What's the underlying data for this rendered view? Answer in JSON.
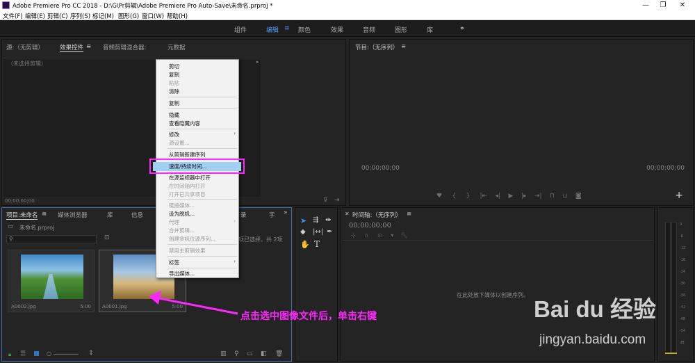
{
  "window": {
    "title": "Adobe Premiere Pro CC 2018 - D:\\G\\Pr剪辑\\Adobe Premiere Pro Auto-Save\\未命名.prproj *",
    "controls": [
      "—",
      "❐",
      "✕"
    ]
  },
  "menu": [
    "文件(F)",
    "编辑(E)",
    "剪辑(C)",
    "序列(S)",
    "标记(M)",
    "图形(G)",
    "窗口(W)",
    "帮助(H)"
  ],
  "workspaces": {
    "items": [
      "组件",
      "编辑",
      "颜色",
      "效果",
      "音频",
      "图形",
      "库"
    ],
    "active": "编辑",
    "menu_icon": "≡",
    "more": "»"
  },
  "source_panel": {
    "tabs": [
      "源:（无剪辑）",
      "效果控件",
      "音频剪辑混合器:",
      "元数据"
    ],
    "active_tab": "效果控件",
    "menu_icon": "≡",
    "no_clip": "（未选择剪辑）",
    "timecode": "00;00;00;00"
  },
  "program_panel": {
    "title": "节目:（无序列）",
    "menu_icon": "≡",
    "timecode_left": "00;00;00;00",
    "timecode_right": "00;00;00;00",
    "add_button": "+"
  },
  "project_panel": {
    "tabs": [
      "项目:未命名",
      "媒体浏览器",
      "库",
      "信息",
      "录",
      "字"
    ],
    "menu_icon": "≡",
    "more": "»",
    "file_name": "未命名.prproj",
    "search_placeholder": "",
    "selection_info": "项已选择，共 2项",
    "items": [
      {
        "name": "A0002.jpg",
        "duration": "5:00"
      },
      {
        "name": "A0001.jpg",
        "duration": "5:00"
      }
    ]
  },
  "timeline_panel": {
    "title": "时间轴:（无序列）",
    "menu_icon": "≡",
    "timecode": "00;00;00;00",
    "empty_hint": "在此处放下媒体以创建序列。"
  },
  "tools": [
    "selection-tool",
    "track-select-tool",
    "ripple-edit-tool",
    "razor-tool",
    "slip-tool",
    "pen-tool",
    "hand-tool",
    "type-tool"
  ],
  "audio_meter": {
    "labels": [
      "0",
      "-6",
      "-12",
      "-18",
      "-24",
      "-30",
      "-36",
      "-42",
      "-48",
      "-54",
      "dB"
    ]
  },
  "context_menu": {
    "items": [
      {
        "label": "剪切",
        "enabled": true
      },
      {
        "label": "复制",
        "enabled": true
      },
      {
        "label": "粘贴",
        "enabled": false
      },
      {
        "label": "清除",
        "enabled": true
      },
      {
        "label": "复制",
        "enabled": true
      },
      {
        "label": "隐藏",
        "enabled": true
      },
      {
        "label": "查看隐藏内容",
        "enabled": true
      },
      {
        "label": "修改",
        "enabled": true,
        "submenu": true
      },
      {
        "label": "源设置...",
        "enabled": false
      },
      {
        "label": "从剪辑新建序列",
        "enabled": true
      },
      {
        "label": "速度/持续时间...",
        "enabled": true,
        "highlighted": true
      },
      {
        "label": "在源监视器中打开",
        "enabled": true
      },
      {
        "label": "在时间轴内打开",
        "enabled": false
      },
      {
        "label": "打开已共享项目",
        "enabled": false
      },
      {
        "label": "链接媒体...",
        "enabled": false
      },
      {
        "label": "设为脱机...",
        "enabled": true
      },
      {
        "label": "代理",
        "enabled": false,
        "submenu": true
      },
      {
        "label": "合并剪辑...",
        "enabled": false
      },
      {
        "label": "创建多机位源序列...",
        "enabled": false
      },
      {
        "label": "禁用主剪辑效果",
        "enabled": false
      },
      {
        "label": "标签",
        "enabled": true,
        "submenu": true
      },
      {
        "label": "导出媒体...",
        "enabled": true
      }
    ],
    "submenu_arrow": "›",
    "highlight_color": "#ff26ff"
  },
  "annotation": {
    "text": "点击选中图像文件后，单击右键",
    "color": "#ff26ff"
  },
  "watermark": {
    "brand": "Bai du 经验",
    "url": "jingyan.baidu.com"
  }
}
